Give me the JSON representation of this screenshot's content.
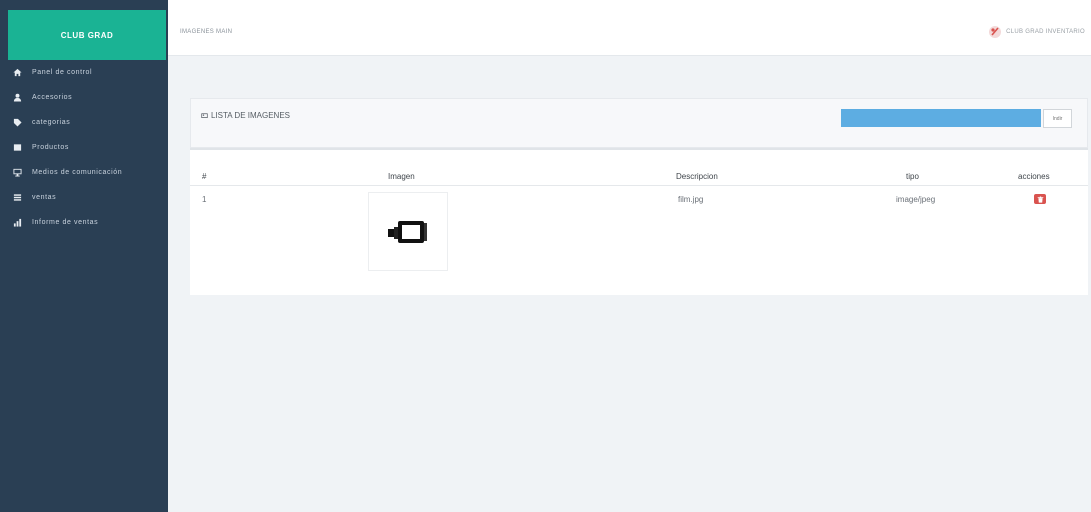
{
  "app": {
    "brand": "CLUB GRAD",
    "breadcrumb": "IMAGENES MAIN",
    "user_name": "CLUB GRAD INVENTARIO"
  },
  "sidebar": {
    "items": [
      {
        "label": "Panel de control",
        "icon": "home-icon"
      },
      {
        "label": "Accesorios",
        "icon": "user-icon"
      },
      {
        "label": "categorias",
        "icon": "tag-icon"
      },
      {
        "label": "Productos",
        "icon": "box-icon"
      },
      {
        "label": "Medios de comunicación",
        "icon": "monitor-icon"
      },
      {
        "label": "ventas",
        "icon": "list-icon"
      },
      {
        "label": "Informe de ventas",
        "icon": "bar-chart-icon"
      }
    ]
  },
  "panel": {
    "title": "LISTA DE IMAGENES",
    "search_value": "",
    "search_button": "Indir"
  },
  "table": {
    "columns": [
      "#",
      "Imagen",
      "Descripcion",
      "tipo",
      "acciones"
    ],
    "rows": [
      {
        "index": "1",
        "descripcion": "film.jpg",
        "tipo": "image/jpeg",
        "action_icon": "delete-icon"
      }
    ]
  },
  "colors": {
    "sidebar": "#2a3f54",
    "brand": "#1ab394",
    "search_bar": "#5dade2",
    "danger": "#d9534f",
    "main_background": "#f0f3f6"
  }
}
